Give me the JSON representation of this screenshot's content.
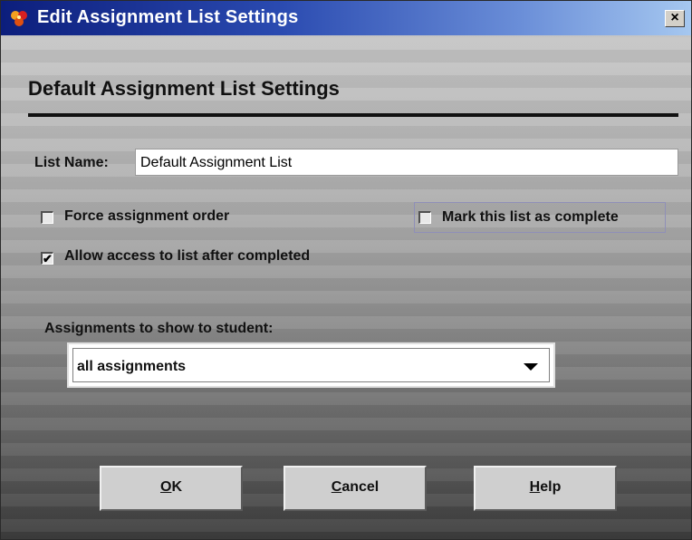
{
  "window": {
    "title": "Edit Assignment List Settings",
    "close_glyph": "×",
    "app_icon": "app-logo-icon"
  },
  "heading": "Default Assignment List Settings",
  "list_name": {
    "label": "List Name:",
    "value": "Default Assignment List"
  },
  "options": {
    "force_order": {
      "label": "Force assignment order",
      "checked": false
    },
    "mark_complete": {
      "label": "Mark this list as complete",
      "checked": false
    },
    "allow_access": {
      "label": "Allow access to list after completed",
      "checked": true
    }
  },
  "assignments": {
    "label": "Assignments to show to student:",
    "selected": "all assignments"
  },
  "buttons": {
    "ok": {
      "mnemonic": "O",
      "rest": "K"
    },
    "cancel": {
      "mnemonic": "C",
      "rest": "ancel"
    },
    "help": {
      "mnemonic": "H",
      "rest": "elp"
    }
  },
  "colors": {
    "titlebar_start": "#0c1e7c",
    "titlebar_end": "#a6c8f0",
    "panel": "#c6c6c6"
  }
}
